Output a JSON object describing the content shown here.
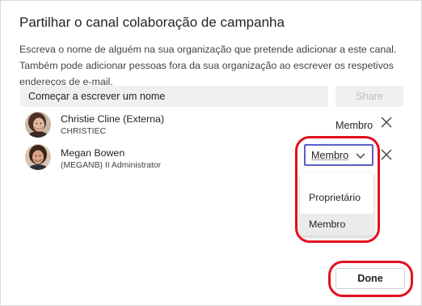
{
  "dialog": {
    "title": "Partilhar o canal colaboração de campanha",
    "description": "Escreva o nome de alguém na sua organização que pretende adicionar a este canal. Também pode adicionar pessoas fora da sua organização ao escrever os respetivos endereços de e-mail."
  },
  "search": {
    "placeholder": "Começar a escrever um nome",
    "share_label": "Share"
  },
  "members": [
    {
      "name": "Christie Cline (Externa)",
      "subtitle": "CHRISTIEC",
      "role": "Membro",
      "avatar": "avatar-christie"
    },
    {
      "name": "Megan Bowen",
      "subtitle": "(MEGANB) II Administrator",
      "role": "Membro",
      "avatar": "avatar-megan"
    }
  ],
  "role_dropdown": {
    "selected": "Membro",
    "options": [
      "Proprietário",
      "Membro"
    ]
  },
  "footer": {
    "done_label": "Done"
  },
  "colors": {
    "accent": "#5b5fc7",
    "highlight": "#e3101f",
    "input_bg": "#f0f0f0"
  }
}
